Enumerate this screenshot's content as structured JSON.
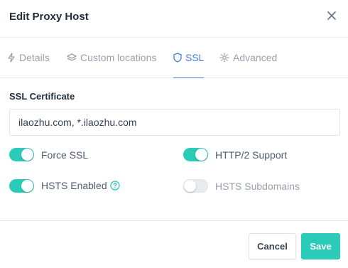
{
  "dialog": {
    "title": "Edit Proxy Host"
  },
  "tabs": [
    {
      "label": "Details",
      "icon": "bolt-icon",
      "active": false
    },
    {
      "label": "Custom locations",
      "icon": "layers-icon",
      "active": false
    },
    {
      "label": "SSL",
      "icon": "shield-icon",
      "active": true
    },
    {
      "label": "Advanced",
      "icon": "gear-icon",
      "active": false
    }
  ],
  "ssl": {
    "certificate_label": "SSL Certificate",
    "certificate_value": "ilaozhu.com, *.ilaozhu.com",
    "toggles": [
      {
        "label": "Force SSL",
        "enabled": true
      },
      {
        "label": "HTTP/2 Support",
        "enabled": true
      },
      {
        "label": "HSTS Enabled",
        "enabled": true,
        "help": true
      },
      {
        "label": "HSTS Subdomains",
        "enabled": false
      }
    ]
  },
  "footer": {
    "cancel_label": "Cancel",
    "save_label": "Save"
  },
  "colors": {
    "accent": "#2bcbba",
    "active_tab": "#467fcf",
    "inactive_text": "#9aa0ac"
  }
}
